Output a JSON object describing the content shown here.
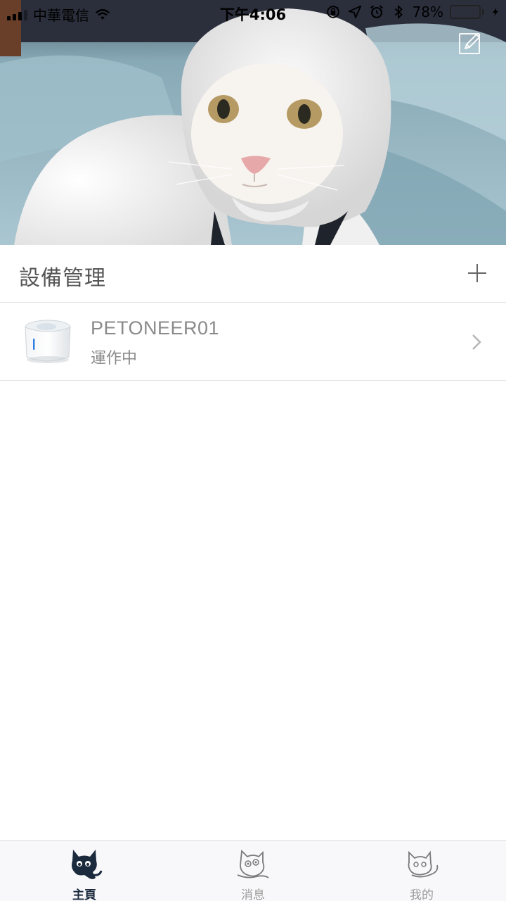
{
  "status_bar": {
    "carrier": "中華電信",
    "time": "下午4:06",
    "battery": "78%",
    "battery_level": 0.78,
    "icons": [
      "signal-icon",
      "wifi-icon",
      "orientation-lock-icon",
      "location-icon",
      "alarm-icon",
      "bluetooth-icon",
      "battery-icon",
      "charging-icon"
    ]
  },
  "hero": {
    "image": "cat-photo",
    "edit_icon": "edit-pencil-icon"
  },
  "section": {
    "title": "設備管理",
    "add_icon": "plus-icon"
  },
  "devices": [
    {
      "name": "PETONEER01",
      "status": "運作中",
      "thumbnail": "water-fountain-icon",
      "chevron_icon": "chevron-right-icon"
    }
  ],
  "tabs": [
    {
      "label": "主頁",
      "icon": "cat-home-icon",
      "active": true
    },
    {
      "label": "消息",
      "icon": "cat-message-icon",
      "active": false
    },
    {
      "label": "我的",
      "icon": "cat-profile-icon",
      "active": false
    }
  ],
  "colors": {
    "accent": "#1c2a3e",
    "battery": "#4cd964",
    "text_secondary": "#8a8a8a"
  }
}
